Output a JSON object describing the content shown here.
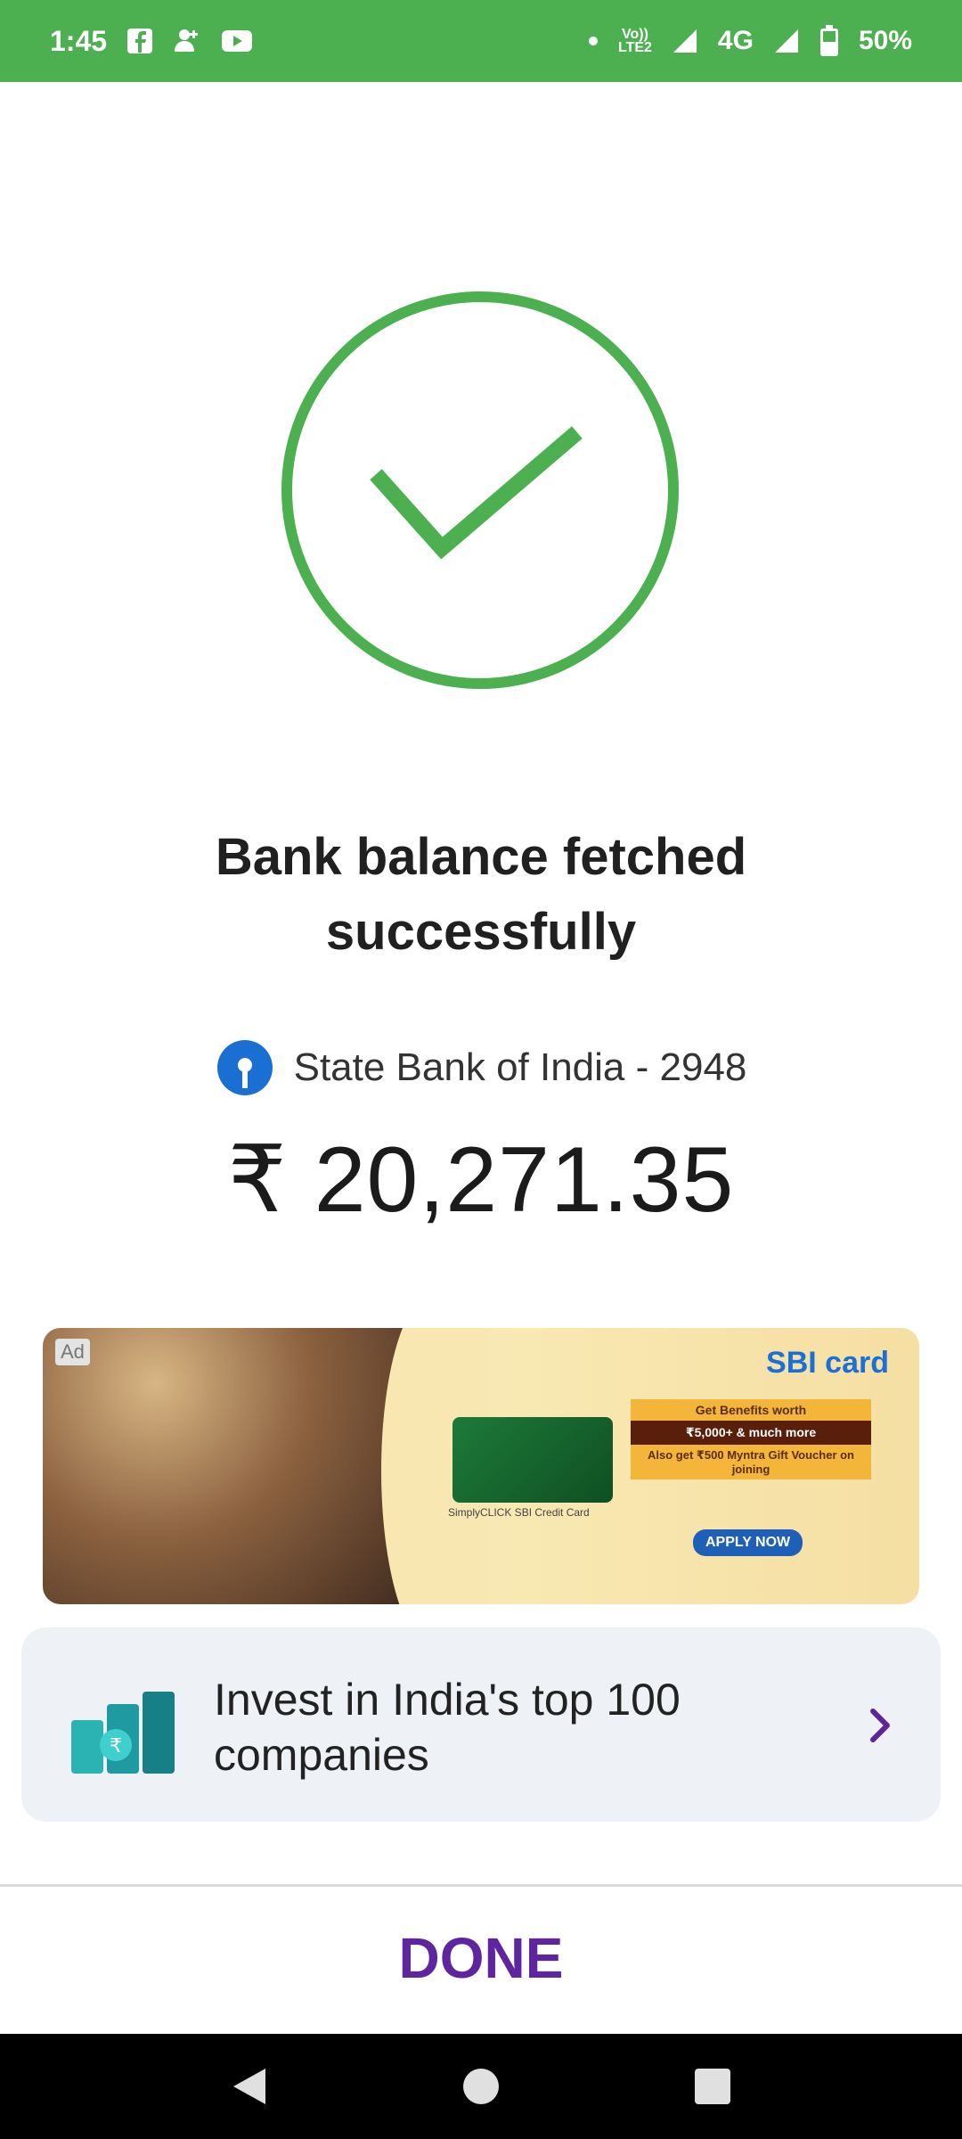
{
  "status_bar": {
    "time": "1:45",
    "network_type": "4G",
    "volte_line1": "Vo))",
    "volte_line2": "LTE2",
    "battery": "50%"
  },
  "success": {
    "headline": "Bank balance fetched successfully",
    "bank_name": "State Bank of India - 2948",
    "balance": "₹ 20,271.35"
  },
  "ad": {
    "badge": "Ad",
    "brand": "SBI card",
    "card_caption": "SimplyCLICK SBI Credit Card",
    "offer_line1": "Get Benefits worth",
    "offer_line2": "₹5,000+ & much more",
    "offer_line3": "Also get ₹500 Myntra Gift Voucher on joining",
    "cta": "APPLY NOW"
  },
  "invest": {
    "text": "Invest in India's top 100 companies"
  },
  "footer": {
    "done_label": "DONE"
  },
  "colors": {
    "status_bar": "#4caf50",
    "check": "#4caf50",
    "accent_purple": "#5f259f",
    "invest_bg": "#eef1f6"
  }
}
